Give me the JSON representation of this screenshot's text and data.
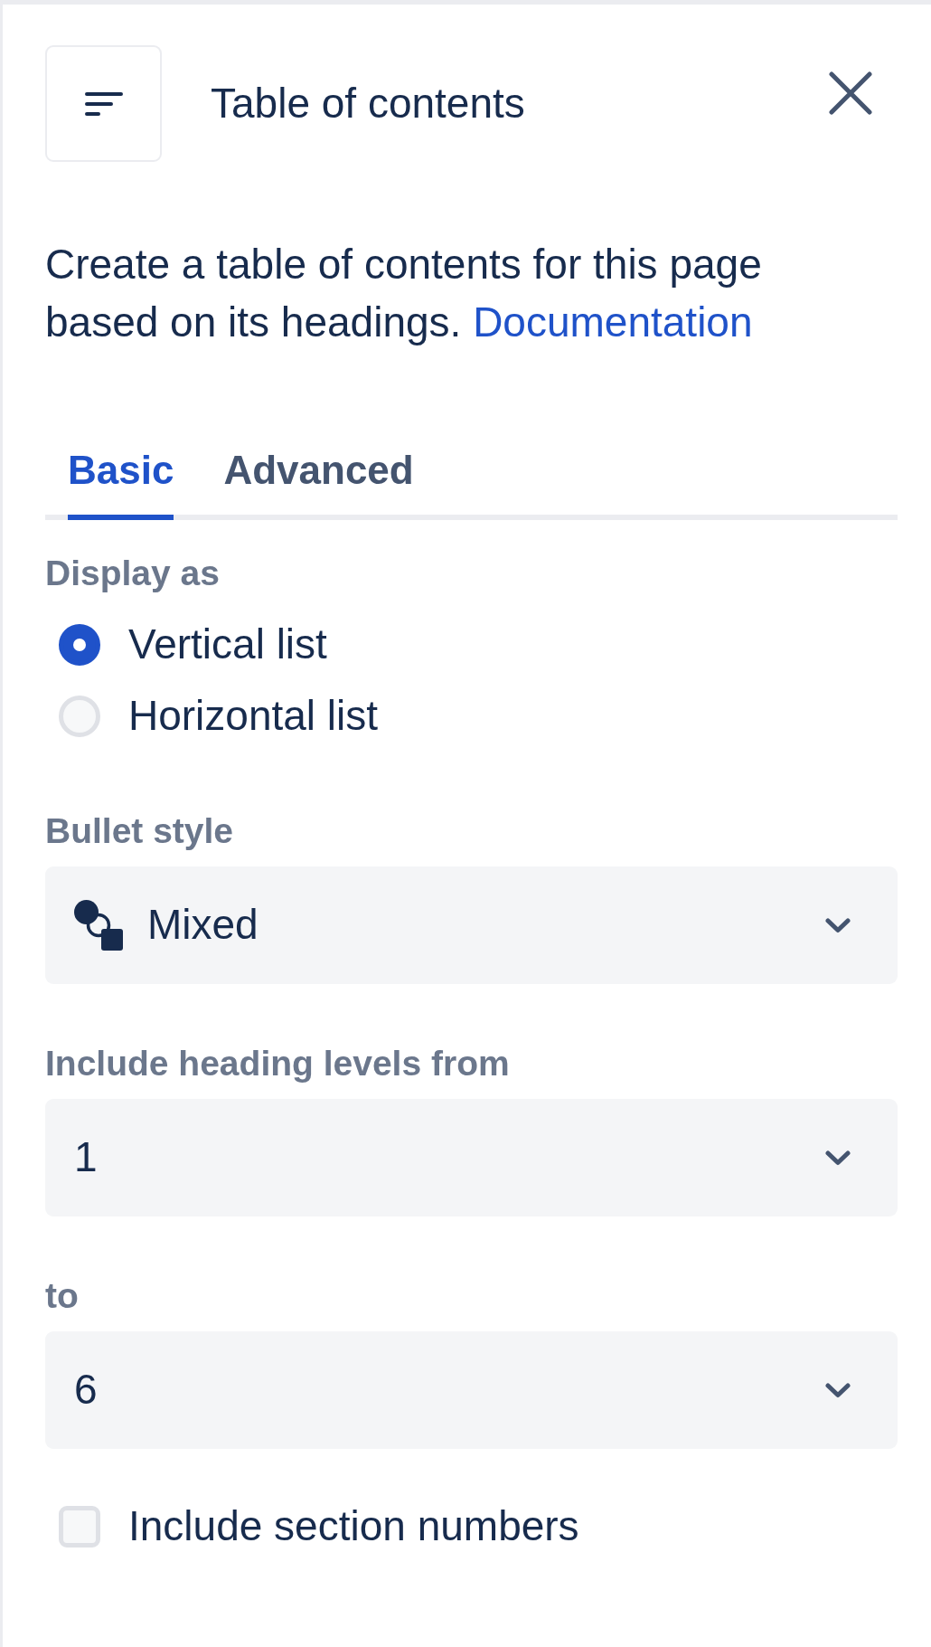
{
  "header": {
    "title": "Table of contents"
  },
  "description": {
    "text": "Create a table of contents for this page based on its headings.",
    "link": "Documentation"
  },
  "tabs": [
    {
      "label": "Basic",
      "selected": true
    },
    {
      "label": "Advanced",
      "selected": false
    }
  ],
  "display_as": {
    "label": "Display as",
    "options": [
      {
        "label": "Vertical list",
        "selected": true
      },
      {
        "label": "Horizontal list",
        "selected": false
      }
    ]
  },
  "fields": [
    {
      "kind": "icon_select",
      "label": "Bullet style",
      "value": "Mixed"
    },
    {
      "kind": "select",
      "label": "Include heading levels from",
      "value": "1"
    },
    {
      "kind": "select",
      "label": "to",
      "value": "6"
    }
  ],
  "checkbox": {
    "label": "Include section numbers",
    "checked": false
  }
}
